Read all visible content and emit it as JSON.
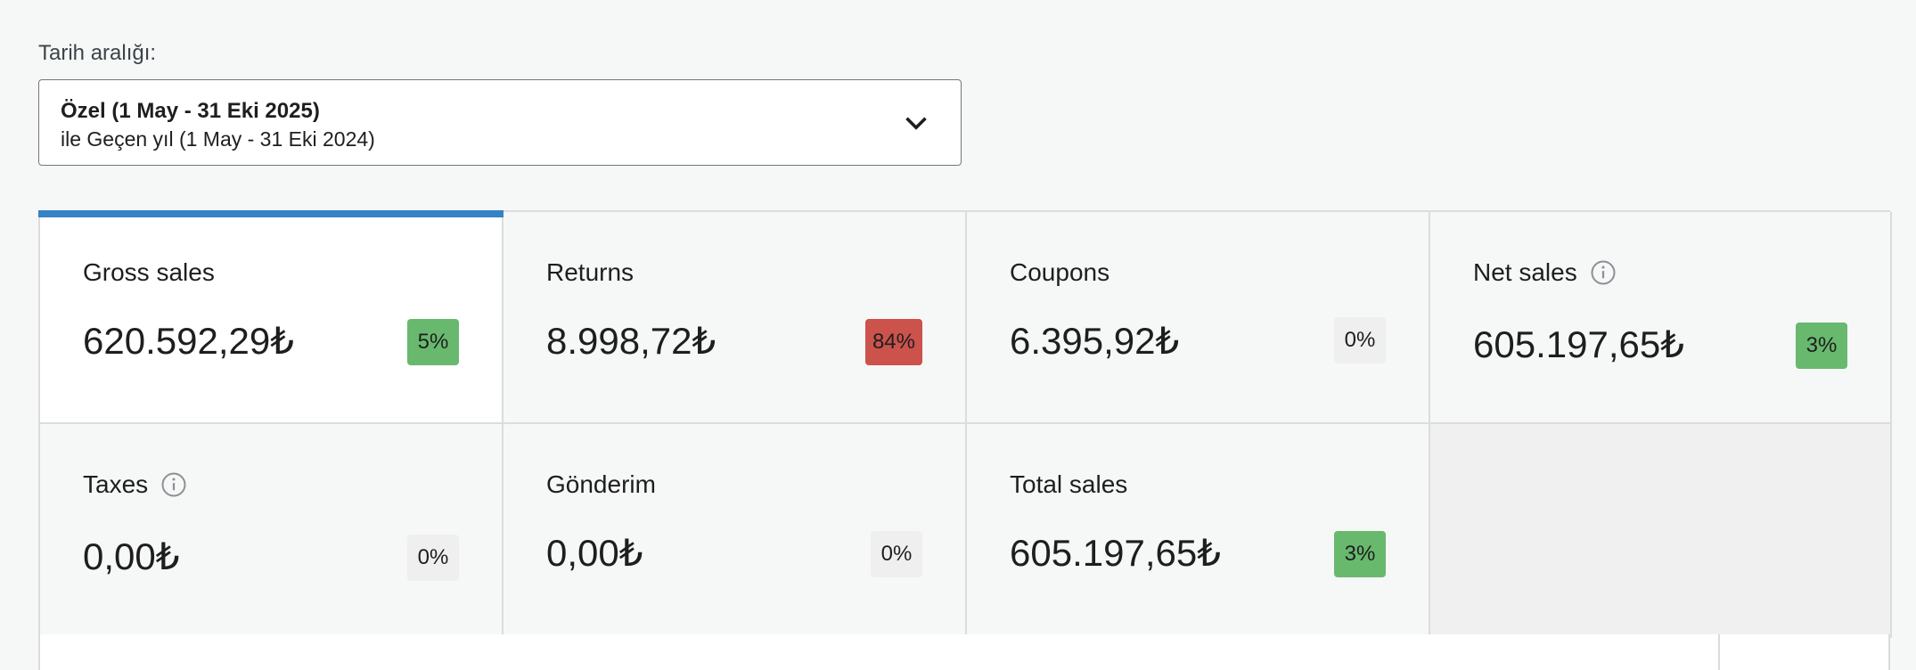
{
  "date_range": {
    "label": "Tarih aralığı:",
    "primary": "Özel (1 May - 31 Eki 2025)",
    "secondary": "ile Geçen yıl (1 May - 31 Eki 2024)",
    "dropdown_icon": "chevron-down-icon"
  },
  "tiles": [
    {
      "title": "Gross sales",
      "value": "620.592,29₺",
      "delta": "5%",
      "trend": "up",
      "selected": true,
      "info": false
    },
    {
      "title": "Returns",
      "value": "8.998,72₺",
      "delta": "84%",
      "trend": "down",
      "selected": false,
      "info": false
    },
    {
      "title": "Coupons",
      "value": "6.395,92₺",
      "delta": "0%",
      "trend": "neutral",
      "selected": false,
      "info": false
    },
    {
      "title": "Net sales",
      "value": "605.197,65₺",
      "delta": "3%",
      "trend": "up",
      "selected": false,
      "info": true
    },
    {
      "title": "Taxes",
      "value": "0,00₺",
      "delta": "0%",
      "trend": "neutral",
      "selected": false,
      "info": true
    },
    {
      "title": "Gönderim",
      "value": "0,00₺",
      "delta": "0%",
      "trend": "neutral",
      "selected": false,
      "info": false
    },
    {
      "title": "Total sales",
      "value": "605.197,65₺",
      "delta": "3%",
      "trend": "up",
      "selected": false,
      "info": false
    }
  ],
  "colors": {
    "accent": "#3582c4",
    "delta_up": "#68b96e",
    "delta_down": "#cc524c",
    "delta_neutral": "#efefef"
  }
}
